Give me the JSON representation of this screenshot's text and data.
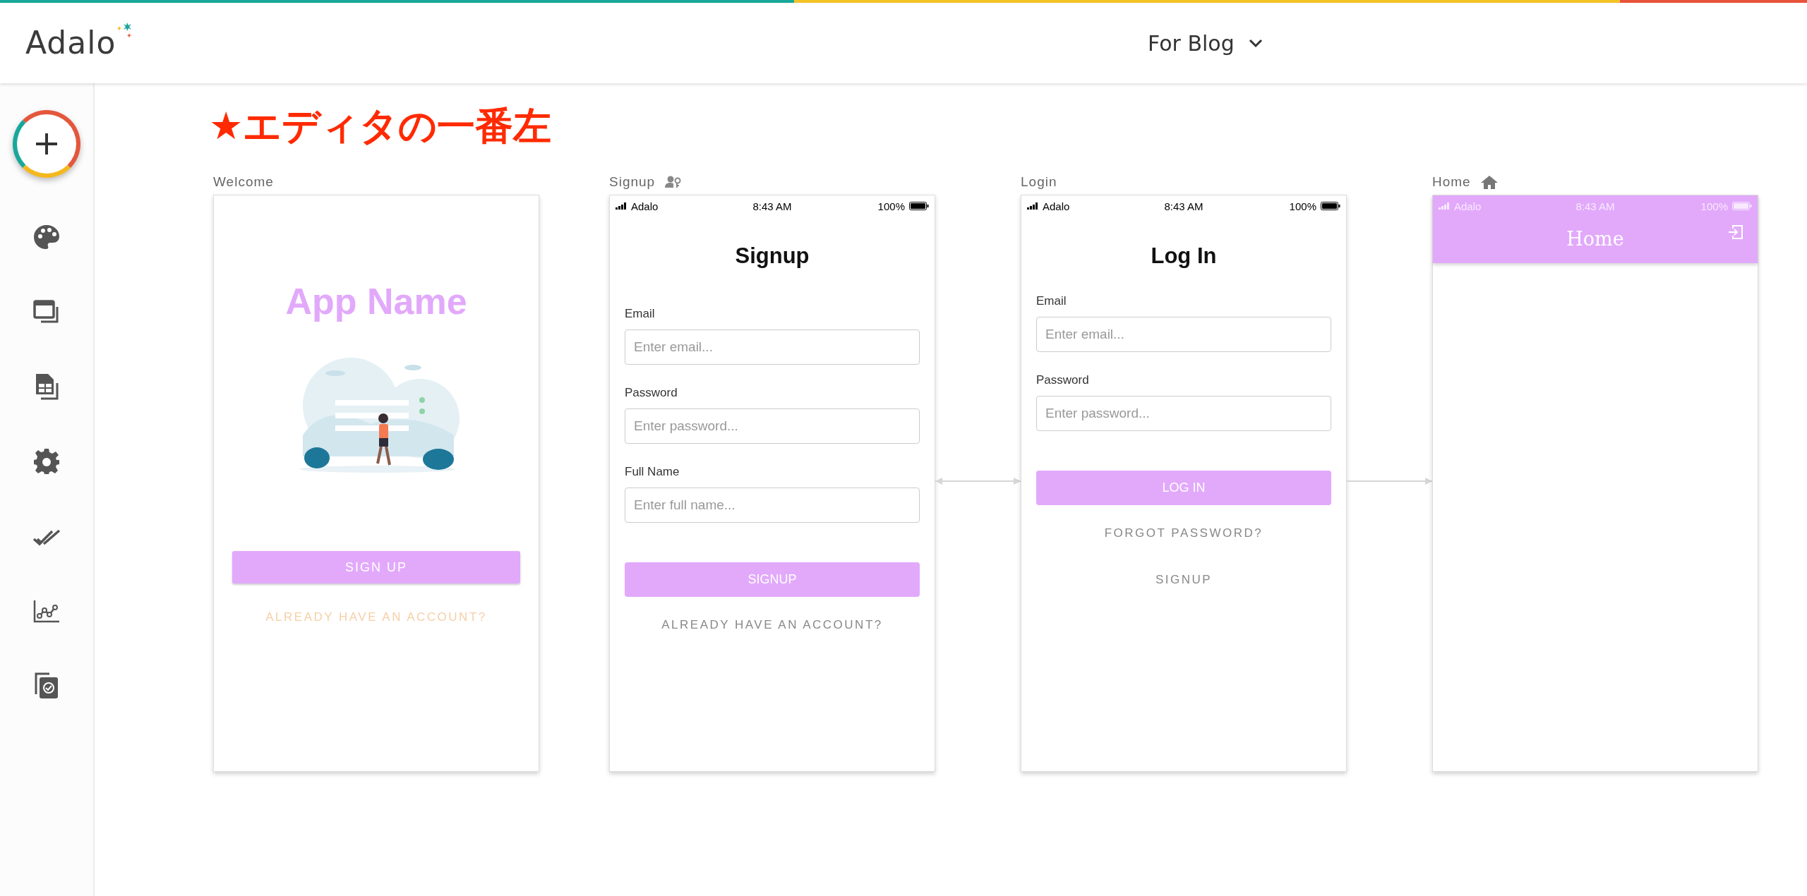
{
  "header": {
    "logo": "Adalo",
    "app_name": "For Blog"
  },
  "annotation": "★エディタの一番左",
  "screens": [
    {
      "kind": "welcome",
      "name": "Welcome",
      "arrow_to_next": false,
      "arrow_from_next": false,
      "app_title": "App Name",
      "button": "SIGN UP",
      "link": "ALREADY HAVE AN ACCOUNT?"
    },
    {
      "kind": "signup",
      "name": "Signup",
      "arrow_to_next": true,
      "arrow_from_next": true,
      "status_bar": {
        "carrier": "Adalo",
        "time": "8:43 AM",
        "battery": "100%"
      },
      "title": "Signup",
      "fields": [
        {
          "label": "Email",
          "placeholder": "Enter email..."
        },
        {
          "label": "Password",
          "placeholder": "Enter password..."
        },
        {
          "label": "Full Name",
          "placeholder": "Enter full name..."
        }
      ],
      "button": "SIGNUP",
      "links": [
        "ALREADY HAVE AN ACCOUNT?"
      ]
    },
    {
      "kind": "login",
      "name": "Login",
      "arrow_to_next": true,
      "arrow_from_next": false,
      "status_bar": {
        "carrier": "Adalo",
        "time": "8:43 AM",
        "battery": "100%"
      },
      "title": "Log In",
      "fields": [
        {
          "label": "Email",
          "placeholder": "Enter email..."
        },
        {
          "label": "Password",
          "placeholder": "Enter password..."
        }
      ],
      "button": "LOG IN",
      "links": [
        "FORGOT PASSWORD?",
        "SIGNUP"
      ]
    },
    {
      "kind": "home",
      "name": "Home",
      "status_bar": {
        "carrier": "Adalo",
        "time": "8:43 AM",
        "battery": "100%"
      },
      "header_title": "Home"
    }
  ]
}
